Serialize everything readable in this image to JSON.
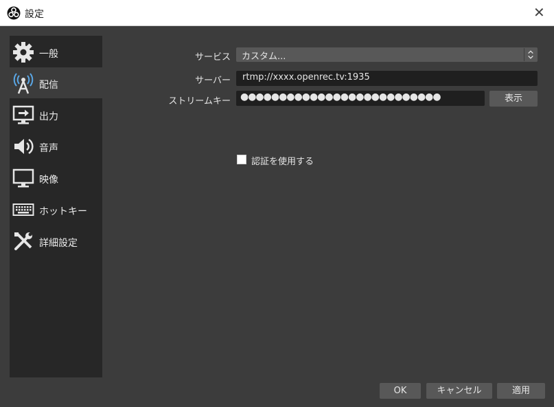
{
  "window": {
    "title": "設定",
    "app_icon": "obs-logo-icon",
    "close_icon": "close-icon"
  },
  "sidebar": {
    "items": [
      {
        "label": "一般",
        "icon": "gear-icon"
      },
      {
        "label": "配信",
        "icon": "broadcast-tower-icon",
        "selected": true
      },
      {
        "label": "出力",
        "icon": "output-monitor-icon"
      },
      {
        "label": "音声",
        "icon": "speaker-icon"
      },
      {
        "label": "映像",
        "icon": "monitor-icon"
      },
      {
        "label": "ホットキー",
        "icon": "keyboard-icon"
      },
      {
        "label": "詳細設定",
        "icon": "tools-icon"
      }
    ]
  },
  "stream": {
    "service_label": "サービス",
    "service_value": "カスタム...",
    "server_label": "サーバー",
    "server_value": "rtmp://xxxx.openrec.tv:1935",
    "key_label": "ストリームキー",
    "key_value": "●●●●●●●●●●●●●●●●●●●●●●●●●●",
    "show_button": "表示",
    "auth_checkbox_label": "認証を使用する",
    "auth_checked": false
  },
  "footer": {
    "ok": "OK",
    "cancel": "キャンセル",
    "apply": "適用"
  }
}
